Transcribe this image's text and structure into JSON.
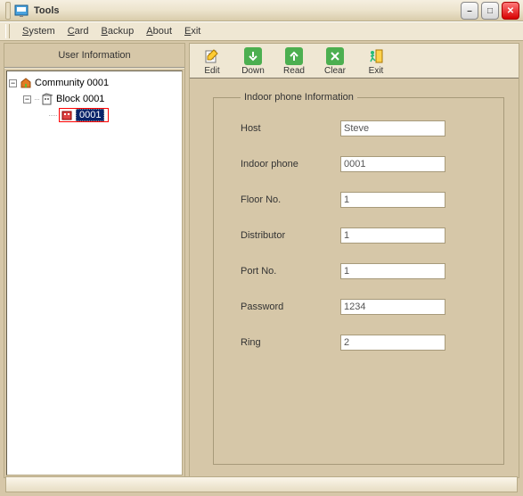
{
  "window": {
    "title": "Tools"
  },
  "menu": {
    "system": "System",
    "card": "Card",
    "backup": "Backup",
    "about": "About",
    "exit": "Exit"
  },
  "left": {
    "header": "User Information",
    "tree": {
      "community": "Community 0001",
      "block": "Block  0001",
      "unit": "0001"
    }
  },
  "toolbar": {
    "edit": "Edit",
    "down": "Down",
    "read": "Read",
    "clear": "Clear",
    "exit": "Exit"
  },
  "form": {
    "legend": "Indoor phone Information",
    "labels": {
      "host": "Host",
      "indoor": "Indoor phone",
      "floor": "Floor No.",
      "distributor": "Distributor",
      "port": "Port No.",
      "password": "Password",
      "ring": "Ring"
    },
    "values": {
      "host": "Steve",
      "indoor": "0001",
      "floor": "1",
      "distributor": "1",
      "port": "1",
      "password": "1234",
      "ring": "2"
    }
  }
}
